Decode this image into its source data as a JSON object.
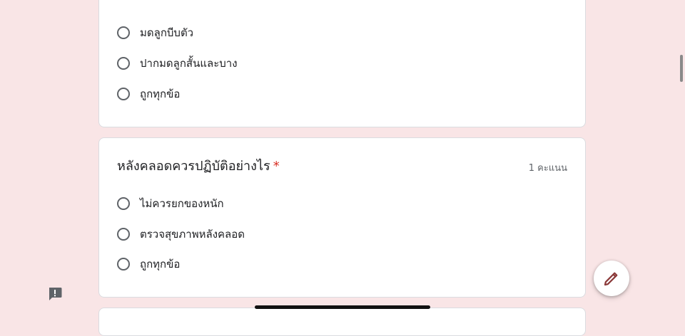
{
  "colors": {
    "page_background": "#f9e5e6",
    "card_background": "#ffffff",
    "required_mark": "#d93025",
    "fab_icon": "#8b3a3a"
  },
  "questions": [
    {
      "options": [
        "มดลูกบีบตัว",
        "ปากมดลูกสั้นและบาง",
        "ถูกทุกข้อ"
      ]
    },
    {
      "title": "หลังคลอดควรปฏิบัติอย่างไร",
      "required_mark": "*",
      "points": "1 คะแนน",
      "options": [
        "ไม่ควรยกของหนัก",
        "ตรวจสุขภาพหลังคลอด",
        "ถูกทุกข้อ"
      ]
    }
  ],
  "icons": {
    "fab": "pencil-icon",
    "feedback": "feedback-icon"
  }
}
